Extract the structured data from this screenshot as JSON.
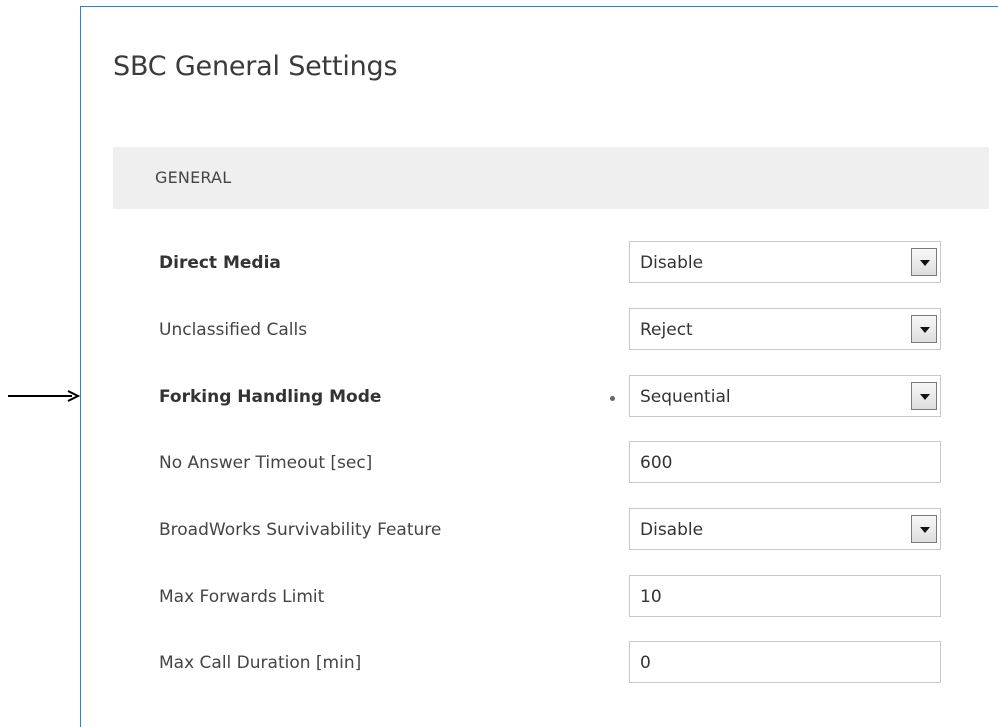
{
  "page": {
    "title": "SBC General Settings"
  },
  "section": {
    "title": "GENERAL"
  },
  "fields": [
    {
      "label": "Direct Media",
      "value": "Disable"
    },
    {
      "label": "Unclassified Calls",
      "value": "Reject"
    },
    {
      "label": "Forking Handling Mode",
      "value": "Sequential"
    },
    {
      "label": "No Answer Timeout [sec]",
      "value": "600"
    },
    {
      "label": "BroadWorks Survivability Feature",
      "value": "Disable"
    },
    {
      "label": "Max Forwards Limit",
      "value": "10"
    },
    {
      "label": "Max Call Duration [min]",
      "value": "0"
    }
  ],
  "colors": {
    "panel_border": "#4a78b8",
    "section_background": "#efefef",
    "field_border": "#c8c8c8"
  },
  "icons": {
    "annotation": "arrow-right-icon",
    "dropdown": "chevron-down-icon",
    "modified": "dot-icon"
  }
}
